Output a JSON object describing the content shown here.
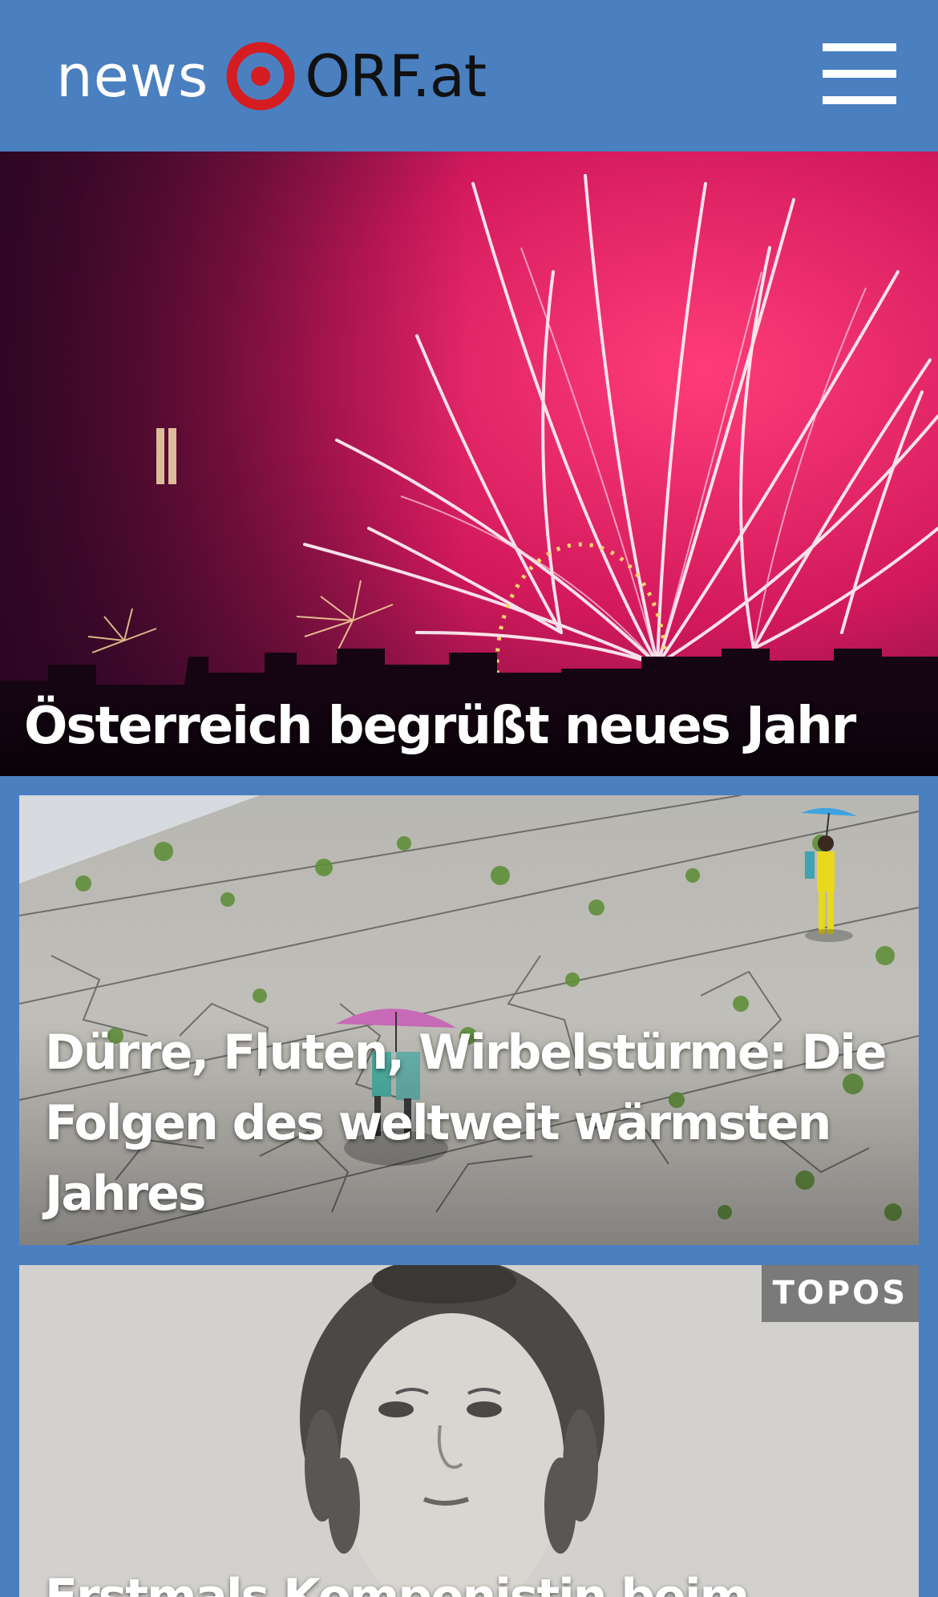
{
  "header": {
    "logo_news": "news",
    "logo_brand": "ORF.at",
    "menu_icon": "hamburger-menu-icon"
  },
  "teasers": [
    {
      "title": "Österreich begrüßt neues Jahr",
      "image": "fireworks-over-vienna-image"
    },
    {
      "title": "Dürre, Fluten, Wirbelstürme: Die Folgen des weltweit wärmsten Jahres",
      "image": "drought-cracked-riverbed-image"
    },
    {
      "title": "Erstmals Komponistin beim",
      "badge": "TOPOS",
      "image": "historical-portrait-woman-image"
    }
  ],
  "colors": {
    "brand_blue": "#4a7fc0",
    "orf_red": "#d51c20",
    "badge_grey": "#7a7a7a"
  }
}
